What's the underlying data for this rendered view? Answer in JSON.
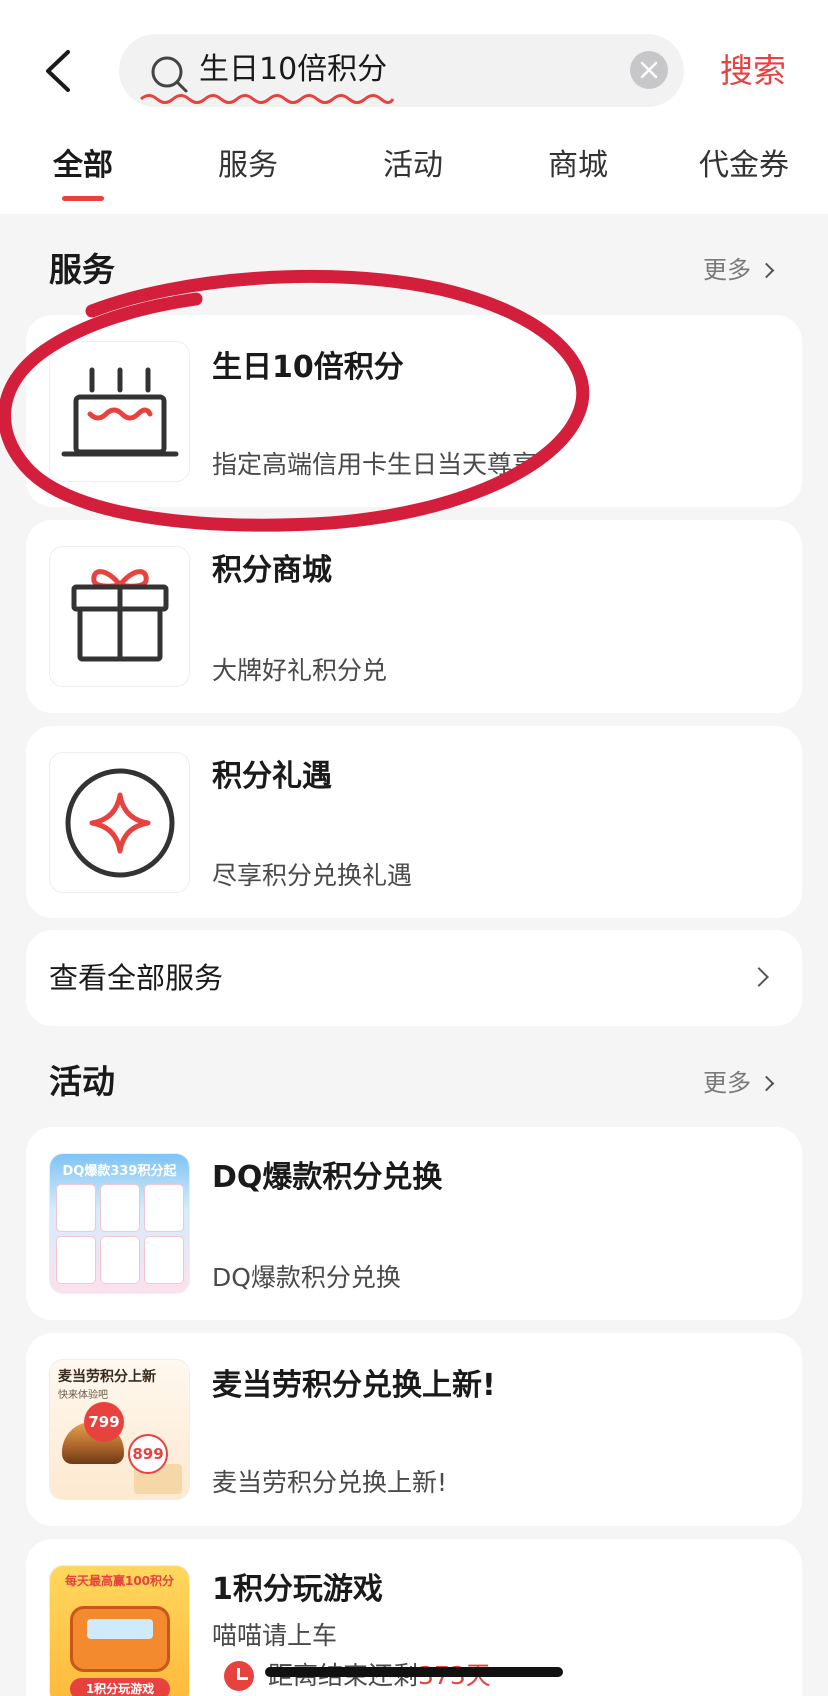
{
  "header": {
    "search_query": "生日10倍积分",
    "search_button": "搜索"
  },
  "tabs": [
    {
      "label": "全部",
      "active": true
    },
    {
      "label": "服务"
    },
    {
      "label": "活动"
    },
    {
      "label": "商城"
    },
    {
      "label": "代金券"
    }
  ],
  "services": {
    "title": "服务",
    "more": "更多",
    "items": [
      {
        "title": "生日10倍积分",
        "subtitle": "指定高端信用卡生日当天尊享",
        "icon": "birthday-cake-icon"
      },
      {
        "title": "积分商城",
        "subtitle": "大牌好礼积分兑",
        "icon": "gift-box-icon"
      },
      {
        "title": "积分礼遇",
        "subtitle": "尽享积分兑换礼遇",
        "icon": "sparkle-star-icon"
      }
    ],
    "view_all": "查看全部服务"
  },
  "activities": {
    "title": "活动",
    "more": "更多",
    "items": [
      {
        "title": "DQ爆款积分兑换",
        "subtitle": "DQ爆款积分兑换",
        "thumb_text": "DQ爆款339积分起"
      },
      {
        "title": "麦当劳积分兑换上新!",
        "subtitle": "麦当劳积分兑换上新!",
        "thumb_title": "麦当劳积分上新",
        "thumb_sub": "快来体验吧",
        "price1": "799",
        "price2": "899"
      },
      {
        "title": "1积分玩游戏",
        "subtitle": "喵喵请上车",
        "thumb_banner": "每天最高赢100积分",
        "thumb_footer": "1积分玩游戏",
        "timer_prefix": "距离结束还剩",
        "timer_days": "373天"
      }
    ]
  },
  "colors": {
    "accent": "#e8423f",
    "annotation": "#d41f3c"
  }
}
